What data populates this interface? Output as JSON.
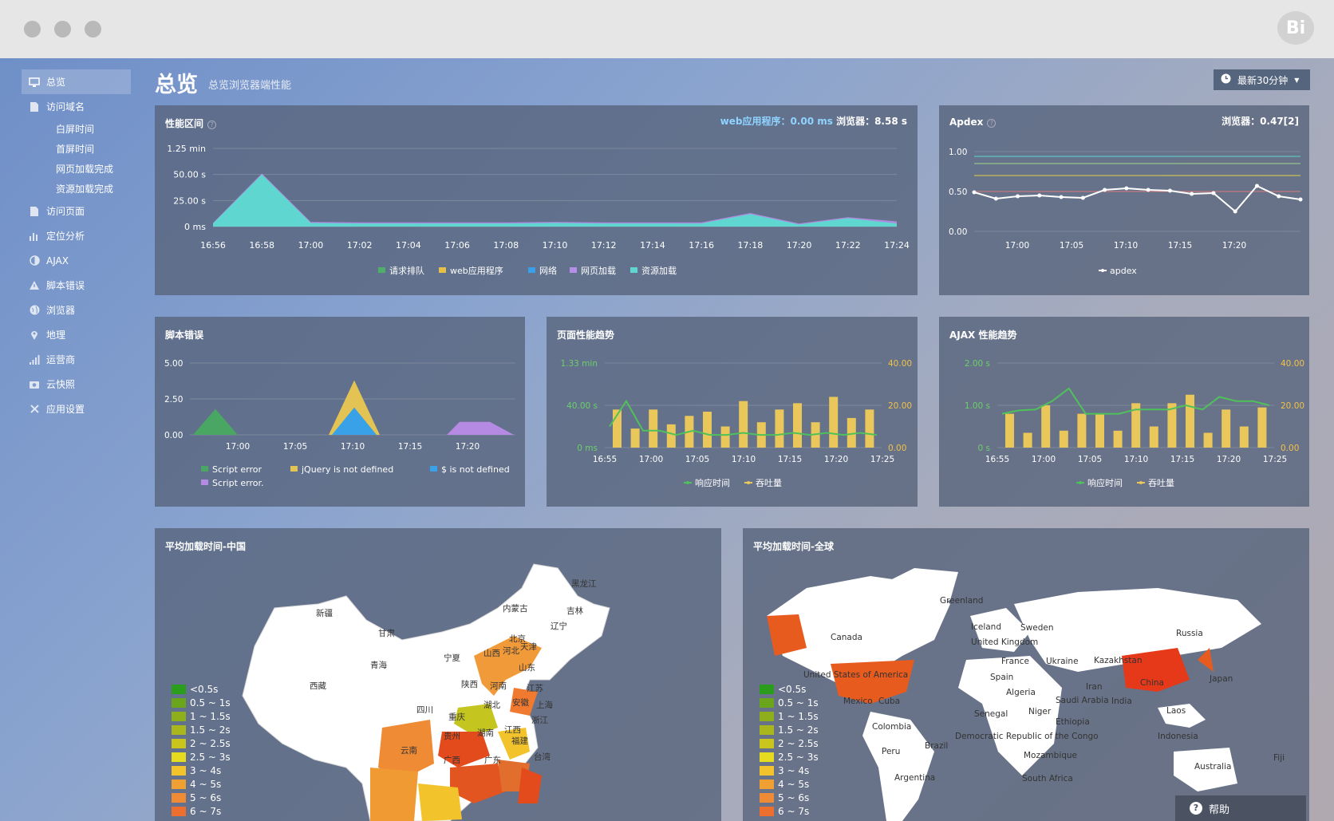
{
  "window": {
    "logo_text": "Bi"
  },
  "header": {
    "title": "总览",
    "subtitle": "总览浏览器端性能",
    "time_range": "最新30分钟"
  },
  "sidebar": {
    "items": [
      {
        "label": "总览",
        "icon": "monitor-icon",
        "active": true
      },
      {
        "label": "访问域名",
        "icon": "document-icon"
      },
      {
        "label": "访问页面",
        "icon": "document-icon"
      },
      {
        "label": "定位分析",
        "icon": "bar-chart-icon"
      },
      {
        "label": "AJAX",
        "icon": "half-circle-icon"
      },
      {
        "label": "脚本错误",
        "icon": "warning-icon"
      },
      {
        "label": "浏览器",
        "icon": "globe-icon"
      },
      {
        "label": "地理",
        "icon": "map-pin-icon"
      },
      {
        "label": "运营商",
        "icon": "signal-icon"
      },
      {
        "label": "云快照",
        "icon": "camera-icon"
      },
      {
        "label": "应用设置",
        "icon": "tools-icon"
      }
    ],
    "subitems": [
      "白屏时间",
      "首屏时间",
      "网页加载完成",
      "资源加载完成"
    ]
  },
  "perf_panel": {
    "title": "性能区间",
    "stat_web": "web应用程序：0.00 ms",
    "stat_browser": "浏览器：8.58 s"
  },
  "apdex_panel": {
    "title": "Apdex",
    "stat": "浏览器：0.47[2]"
  },
  "script_panel": {
    "title": "脚本错误"
  },
  "page_panel": {
    "title": "页面性能趋势"
  },
  "ajax_panel": {
    "title": "AJAX 性能趋势"
  },
  "china_map": {
    "title": "平均加载时间-中国",
    "regions": [
      "新疆",
      "西藏",
      "青海",
      "甘肃",
      "内蒙古",
      "黑龙江",
      "吉林",
      "辽宁",
      "北京",
      "天津",
      "河北",
      "山西",
      "宁夏",
      "陕西",
      "河南",
      "山东",
      "江苏",
      "安徽",
      "上海",
      "湖北",
      "四川",
      "重庆",
      "贵州",
      "湖南",
      "江西",
      "浙江",
      "云南",
      "广西",
      "广东",
      "福建",
      "台湾"
    ]
  },
  "world_map": {
    "title": "平均加载时间-全球",
    "countries": [
      "Greenland",
      "Canada",
      "Iceland",
      "Sweden",
      "United Kingdom",
      "Russia",
      "France",
      "Ukraine",
      "Kazakhstan",
      "Spain",
      "United States of America",
      "China",
      "Japan",
      "Algeria",
      "Iran",
      "Mexico",
      "Cuba",
      "Saudi Arabia",
      "India",
      "Senegal",
      "Niger",
      "Laos",
      "Ethiopia",
      "Colombia",
      "Brazil",
      "Indonesia",
      "Democratic Republic of the Congo",
      "Peru",
      "Mozambique",
      "Fiji",
      "Australia",
      "Argentina",
      "South Africa"
    ]
  },
  "map_legend": [
    {
      "label": "<0.5s",
      "color": "#2a9d1c"
    },
    {
      "label": "0.5 ~ 1s",
      "color": "#6aa51b"
    },
    {
      "label": "1 ~ 1.5s",
      "color": "#8fae1b"
    },
    {
      "label": "1.5 ~ 2s",
      "color": "#aab71c"
    },
    {
      "label": "2 ~ 2.5s",
      "color": "#c9c51d"
    },
    {
      "label": "2.5 ~ 3s",
      "color": "#e7db1f"
    },
    {
      "label": "3 ~ 4s",
      "color": "#f2c32a"
    },
    {
      "label": "4 ~ 5s",
      "color": "#f0a033"
    },
    {
      "label": "5 ~ 6s",
      "color": "#ef8a35"
    },
    {
      "label": "6 ~ 7s",
      "color": "#ec6f30"
    }
  ],
  "help": {
    "label": "帮助"
  },
  "chart_data": [
    {
      "type": "area",
      "title": "性能区间",
      "x": [
        "16:56",
        "16:58",
        "17:00",
        "17:02",
        "17:04",
        "17:06",
        "17:08",
        "17:10",
        "17:12",
        "17:14",
        "17:16",
        "17:18",
        "17:20",
        "17:22",
        "17:24"
      ],
      "yticks": [
        "0 ms",
        "25.00 s",
        "50.00 s",
        "1.25 min"
      ],
      "ylim": [
        0,
        75
      ],
      "series": [
        {
          "name": "请求排队",
          "color": "#4fae6a",
          "values": [
            0,
            0,
            0,
            0,
            0,
            0,
            0,
            0,
            0,
            0,
            0,
            0,
            0,
            0,
            0
          ]
        },
        {
          "name": "web应用程序",
          "color": "#e7c04a",
          "values": [
            0,
            0,
            0,
            0,
            0,
            0,
            0,
            0,
            0,
            0,
            0,
            0,
            0,
            0,
            0
          ]
        },
        {
          "name": "网络",
          "color": "#3a9ee8",
          "values": [
            0,
            0,
            0,
            0,
            0,
            0,
            0,
            0,
            0,
            0,
            0,
            0,
            0,
            0,
            0
          ]
        },
        {
          "name": "网页加载",
          "color": "#b78ee8",
          "values": [
            3.5,
            51,
            4.5,
            4,
            4,
            4,
            4,
            4.5,
            4,
            4,
            4,
            13,
            3,
            9,
            5
          ]
        },
        {
          "name": "资源加载",
          "color": "#5fd6d0",
          "values": [
            3,
            50,
            3.5,
            3,
            3,
            3,
            3,
            3.5,
            3,
            3,
            3,
            12,
            2,
            8,
            3
          ]
        }
      ]
    },
    {
      "type": "line",
      "title": "Apdex",
      "x_ticks": [
        "17:00",
        "17:05",
        "17:10",
        "17:15",
        "17:20"
      ],
      "yticks": [
        "0.00",
        "0.50",
        "1.00"
      ],
      "ylim": [
        0,
        1
      ],
      "series": [
        {
          "name": "apdex",
          "color": "#ffffff",
          "values": [
            0.49,
            0.41,
            0.44,
            0.45,
            0.43,
            0.42,
            0.52,
            0.54,
            0.52,
            0.51,
            0.47,
            0.48,
            0.25,
            0.57,
            0.44,
            0.4
          ]
        }
      ],
      "reference_lines": [
        0.94,
        0.85,
        0.7,
        0.5
      ]
    },
    {
      "type": "area",
      "title": "脚本错误",
      "x_ticks": [
        "17:00",
        "17:05",
        "17:10",
        "17:15",
        "17:20"
      ],
      "yticks": [
        "0.00",
        "2.50",
        "5.00"
      ],
      "ylim": [
        0,
        5
      ],
      "series": [
        {
          "name": "Script error",
          "color": "#4aa763"
        },
        {
          "name": "jQuery is not defined",
          "color": "#e3c354"
        },
        {
          "name": "$ is not defined",
          "color": "#38a1e8"
        },
        {
          "name": "Script error.",
          "color": "#b58ae2"
        }
      ]
    },
    {
      "type": "bar",
      "title": "页面性能趋势",
      "x_ticks": [
        "16:55",
        "17:00",
        "17:05",
        "17:10",
        "17:15",
        "17:20",
        "17:25"
      ],
      "y_left_ticks": [
        "0 ms",
        "40.00 s",
        "1.33 min"
      ],
      "y_right_ticks": [
        "0.00",
        "20.00",
        "40.00"
      ],
      "series": [
        {
          "name": "响应时间",
          "color": "#4fc15a",
          "values": [
            0.5,
            1.1,
            0.4,
            0.4,
            0.3,
            0.4,
            0.3,
            0.3,
            0.35,
            0.3,
            0.3,
            0.35,
            0.3,
            0.35,
            0.3,
            0.35,
            0.3
          ]
        },
        {
          "name": "吞吐量",
          "color": "#e9c75a",
          "values": [
            18,
            9,
            18,
            11,
            15,
            17,
            10,
            22,
            12,
            18,
            21,
            12,
            24,
            14,
            18
          ]
        }
      ]
    },
    {
      "type": "bar",
      "title": "AJAX 性能趋势",
      "x_ticks": [
        "16:55",
        "17:00",
        "17:05",
        "17:10",
        "17:15",
        "17:20",
        "17:25"
      ],
      "y_left_ticks": [
        "0 s",
        "1.00 s",
        "2.00 s"
      ],
      "y_right_ticks": [
        "0.00",
        "20.00",
        "40.00"
      ],
      "series": [
        {
          "name": "响应时间",
          "color": "#4fc15a",
          "values": [
            0.8,
            0.88,
            0.9,
            1.1,
            1.4,
            0.8,
            0.8,
            0.8,
            0.9,
            0.9,
            0.9,
            1.0,
            0.9,
            1.2,
            1.1,
            1.1,
            1.0
          ]
        },
        {
          "name": "吞吐量",
          "color": "#e9c75a",
          "values": [
            16,
            7,
            20,
            8,
            16,
            16,
            8,
            21,
            10,
            21,
            25,
            7,
            18,
            10,
            19
          ]
        }
      ]
    }
  ]
}
